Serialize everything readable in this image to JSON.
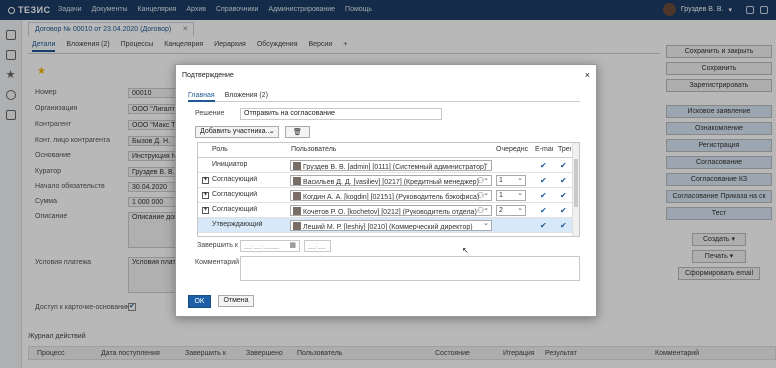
{
  "app": {
    "logo": "ТЕЗИС",
    "menu": [
      "Задачи",
      "Документы",
      "Канцелярия",
      "Архив",
      "Справочники",
      "Администрирование",
      "Помощь"
    ],
    "user": "Груздев В. В."
  },
  "document": {
    "tab": "Договор № 00010 от 23.04.2020 (Договор)",
    "subtabs": [
      "Детали",
      "Вложения (2)",
      "Процессы",
      "Канцелярия",
      "Иерархия",
      "Обсуждения",
      "Версии",
      "+"
    ],
    "fields": [
      {
        "label": "Номер",
        "value": "00010"
      },
      {
        "label": "Организация",
        "value": "ООО \"Лигалт"
      },
      {
        "label": "Контрагент",
        "value": "ООО \"Макс Т"
      },
      {
        "label": "Конт. лицо контрагента",
        "value": "Бызов Д. Н."
      },
      {
        "label": "Основание",
        "value": "Инструкция №"
      },
      {
        "label": "Куратор",
        "value": "Груздев В. В."
      },
      {
        "label": "Начало обязательств",
        "value": "30.04.2020"
      },
      {
        "label": "Сумма",
        "value": "1 000 000"
      },
      {
        "label": "Описание",
        "value": "Описание дог"
      },
      {
        "label": "Условия платежа",
        "value": "Условия плат"
      }
    ],
    "access_label": "Доступ к карточке-основанию",
    "journal": {
      "title": "Журнал действий",
      "columns": [
        "Процесс",
        "Дата поступления",
        "Завершить к",
        "Завершено",
        "Пользователь",
        "Состояние",
        "Итерация",
        "Результат",
        "Комментарий"
      ]
    }
  },
  "right_panel": {
    "buttons": [
      "Сохранить и закрыть",
      "Сохранить",
      "Зарегистрировать"
    ],
    "process_buttons": [
      "Исковое заявление",
      "Ознакомление",
      "Регистрация",
      "Согласование",
      "Согласование КЗ",
      "Согласование Приказа на ск",
      "Тест"
    ],
    "create": "Создать",
    "print": "Печать",
    "email": "Сформировать email"
  },
  "dialog": {
    "title": "Подтверждение",
    "close": "×",
    "tabs": [
      "Главная",
      "Вложения (2)"
    ],
    "decision_label": "Решение",
    "decision_value": "Отправить на согласование",
    "add_participant": "Добавить участника...",
    "columns": {
      "role": "Роль",
      "user": "Пользователь",
      "order": "Очереднс",
      "email": "E-mai",
      "req": "Треі"
    },
    "rows": [
      {
        "role": "Инициатор",
        "user": "Груздев В. В. [admin] [0111] (Системный администратор)",
        "order": "",
        "expand": false,
        "group": false
      },
      {
        "role": "Согласующий",
        "user": "Васильев Д. Д. [vasiliev] [0217] (Кредитный менеджер)",
        "order": "1",
        "expand": true,
        "group": true
      },
      {
        "role": "Согласующий",
        "user": "Когдин А. А. [kogdin] [02151] (Руководитель бэкофиса)",
        "order": "1",
        "expand": true,
        "group": true
      },
      {
        "role": "Согласующий",
        "user": "Кочетов Р. О. [kochetov] [0212] (Руководитель отдела)",
        "order": "2",
        "expand": true,
        "group": true
      },
      {
        "role": "Утверждающий",
        "user": "Леший М. Р. [leshiy] [0210] (Коммерческий директор)",
        "order": "",
        "expand": false,
        "group": false
      }
    ],
    "check_mark": "✔",
    "finish_label": "Завершить к",
    "date_placeholder": "__.__.____",
    "time_placeholder": "__:__",
    "comment_label": "Комментарий",
    "ok": "OK",
    "cancel": "Отмена"
  }
}
